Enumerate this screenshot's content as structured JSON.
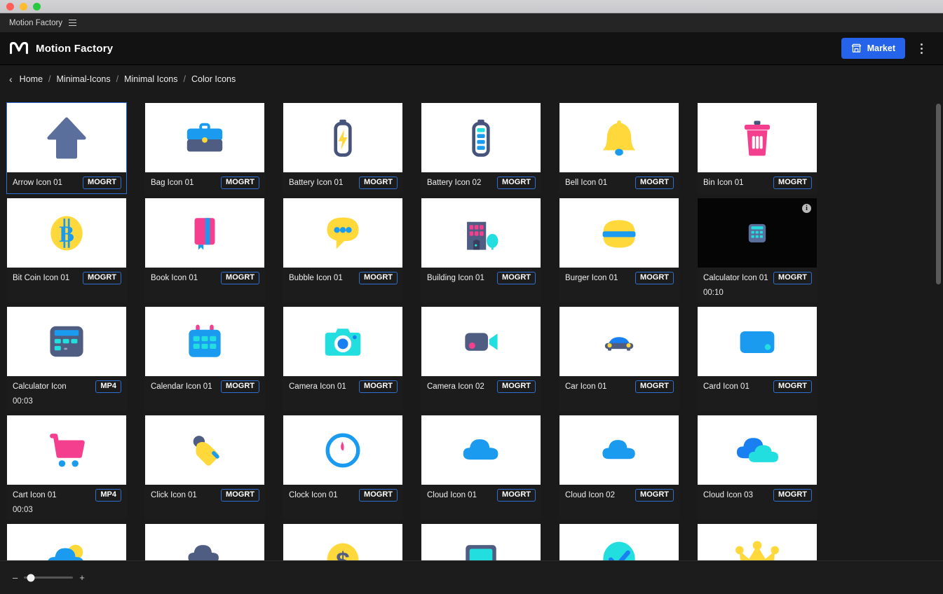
{
  "window": {
    "traffic_lights": [
      "close",
      "minimize",
      "maximize"
    ],
    "app_menu_title": "Motion Factory",
    "menu_icon": "hamburger-icon"
  },
  "header": {
    "logo_icon": "motion-factory-logo-icon",
    "brand": "Motion Factory",
    "market_label": "Market",
    "market_icon": "store-icon",
    "market_color": "#2563eb",
    "overflow_icon": "kebab-menu-icon"
  },
  "breadcrumb": {
    "back_icon": "chevron-left-icon",
    "separator": "/",
    "items": [
      {
        "label": "Home"
      },
      {
        "label": "Minimal-Icons"
      },
      {
        "label": "Minimal Icons"
      },
      {
        "label": "Color Icons"
      }
    ]
  },
  "grid": {
    "selected_index": 0,
    "selection_color": "#2f6fd0",
    "items": [
      {
        "title": "Arrow Icon 01",
        "tag": "MOGRT",
        "icon": "arrow-up-icon",
        "duration": "",
        "dark": false,
        "info": false
      },
      {
        "title": "Bag Icon 01",
        "tag": "MOGRT",
        "icon": "briefcase-icon",
        "duration": "",
        "dark": false,
        "info": false
      },
      {
        "title": "Battery Icon 01",
        "tag": "MOGRT",
        "icon": "battery-bolt-icon",
        "duration": "",
        "dark": false,
        "info": false
      },
      {
        "title": "Battery Icon 02",
        "tag": "MOGRT",
        "icon": "battery-level-icon",
        "duration": "",
        "dark": false,
        "info": false
      },
      {
        "title": "Bell Icon 01",
        "tag": "MOGRT",
        "icon": "bell-icon",
        "duration": "",
        "dark": false,
        "info": false
      },
      {
        "title": "Bin Icon 01",
        "tag": "MOGRT",
        "icon": "trash-bin-icon",
        "duration": "",
        "dark": false,
        "info": false
      },
      {
        "title": "Bit Coin Icon 01",
        "tag": "MOGRT",
        "icon": "bitcoin-icon",
        "duration": "",
        "dark": false,
        "info": false
      },
      {
        "title": "Book Icon 01",
        "tag": "MOGRT",
        "icon": "book-icon",
        "duration": "",
        "dark": false,
        "info": false
      },
      {
        "title": "Bubble Icon 01",
        "tag": "MOGRT",
        "icon": "speech-bubble-icon",
        "duration": "",
        "dark": false,
        "info": false
      },
      {
        "title": "Building Icon 01",
        "tag": "MOGRT",
        "icon": "building-icon",
        "duration": "",
        "dark": false,
        "info": false
      },
      {
        "title": "Burger Icon 01",
        "tag": "MOGRT",
        "icon": "burger-icon",
        "duration": "",
        "dark": false,
        "info": false
      },
      {
        "title": "Calculator Icon 01",
        "tag": "MOGRT",
        "icon": "calculator-icon",
        "duration": "00:10",
        "dark": true,
        "info": true
      },
      {
        "title": "Calculator Icon",
        "tag": "MP4",
        "icon": "calculator-wide-icon",
        "duration": "00:03",
        "dark": false,
        "info": false
      },
      {
        "title": "Calendar Icon 01",
        "tag": "MOGRT",
        "icon": "calendar-icon",
        "duration": "",
        "dark": false,
        "info": false
      },
      {
        "title": "Camera Icon 01",
        "tag": "MOGRT",
        "icon": "photo-camera-icon",
        "duration": "",
        "dark": false,
        "info": false
      },
      {
        "title": "Camera Icon 02",
        "tag": "MOGRT",
        "icon": "video-camera-icon",
        "duration": "",
        "dark": false,
        "info": false
      },
      {
        "title": "Car Icon 01",
        "tag": "MOGRT",
        "icon": "car-icon",
        "duration": "",
        "dark": false,
        "info": false
      },
      {
        "title": "Card Icon 01",
        "tag": "MOGRT",
        "icon": "credit-card-icon",
        "duration": "",
        "dark": false,
        "info": false
      },
      {
        "title": "Cart Icon 01",
        "tag": "MP4",
        "icon": "shopping-cart-icon",
        "duration": "00:03",
        "dark": false,
        "info": false
      },
      {
        "title": "Click Icon 01",
        "tag": "MOGRT",
        "icon": "click-hand-icon",
        "duration": "",
        "dark": false,
        "info": false
      },
      {
        "title": "Clock Icon 01",
        "tag": "MOGRT",
        "icon": "clock-icon",
        "duration": "",
        "dark": false,
        "info": false
      },
      {
        "title": "Cloud Icon 01",
        "tag": "MOGRT",
        "icon": "cloud-icon",
        "duration": "",
        "dark": false,
        "info": false
      },
      {
        "title": "Cloud Icon 02",
        "tag": "MOGRT",
        "icon": "cloud-alt-icon",
        "duration": "",
        "dark": false,
        "info": false
      },
      {
        "title": "Cloud Icon 03",
        "tag": "MOGRT",
        "icon": "double-cloud-icon",
        "duration": "",
        "dark": false,
        "info": false
      },
      {
        "title": "",
        "tag": "",
        "icon": "cloud-sun-icon",
        "duration": "",
        "dark": false,
        "info": false
      },
      {
        "title": "",
        "tag": "",
        "icon": "cloud-rain-icon",
        "duration": "",
        "dark": false,
        "info": false
      },
      {
        "title": "",
        "tag": "",
        "icon": "dollar-coin-icon",
        "duration": "",
        "dark": false,
        "info": false
      },
      {
        "title": "",
        "tag": "",
        "icon": "monitor-icon",
        "duration": "",
        "dark": false,
        "info": false
      },
      {
        "title": "",
        "tag": "",
        "icon": "check-circle-icon",
        "duration": "",
        "dark": false,
        "info": false
      },
      {
        "title": "",
        "tag": "",
        "icon": "crown-icon",
        "duration": "",
        "dark": false,
        "info": false
      }
    ]
  },
  "footer": {
    "zoom_out_label": "–",
    "zoom_in_label": "+",
    "zoom_value": 14
  }
}
